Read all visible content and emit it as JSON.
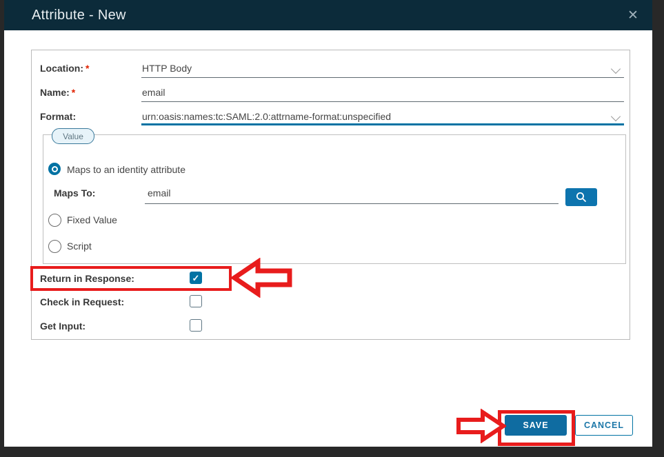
{
  "dialog": {
    "title": "Attribute - New"
  },
  "form": {
    "location": {
      "label": "Location:",
      "required": "*",
      "value": "HTTP Body"
    },
    "name": {
      "label": "Name:",
      "required": "*",
      "value": "email"
    },
    "format": {
      "label": "Format:",
      "value": "urn:oasis:names:tc:SAML:2.0:attrname-format:unspecified"
    },
    "value_section": {
      "tab_label": "Value",
      "radio_maps_label": "Maps to an identity attribute",
      "maps_to": {
        "label": "Maps To:",
        "value": "email"
      },
      "radio_fixed_label": "Fixed Value",
      "radio_script_label": "Script"
    },
    "checkboxes": [
      {
        "label": "Return in Response:",
        "checked": true
      },
      {
        "label": "Check in Request:",
        "checked": false
      },
      {
        "label": "Get Input:",
        "checked": false
      }
    ]
  },
  "footer": {
    "save_label": "SAVE",
    "cancel_label": "CANCEL"
  },
  "icons": {
    "close": "✕",
    "checkmark": "✓",
    "search": "magnifier",
    "chevron": "chevron-down"
  },
  "colors": {
    "header_bg": "#0c2b3a",
    "accent_blue": "#0072a3",
    "annotation_red": "#e81c1c",
    "pill_bg": "#e7f3f9"
  }
}
